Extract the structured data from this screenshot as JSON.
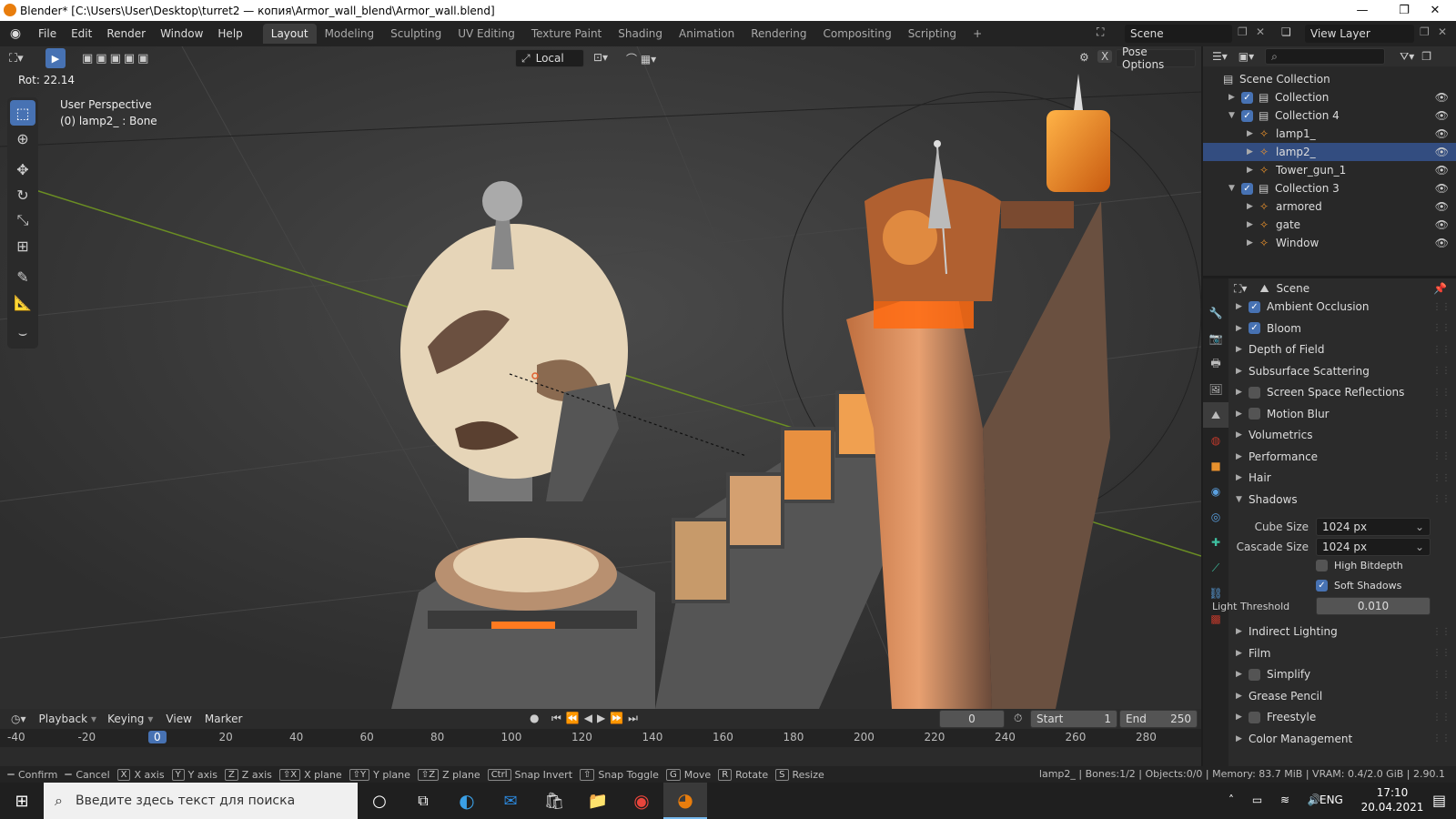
{
  "window": {
    "title": "Blender* [C:\\Users\\User\\Desktop\\turret2 — копия\\Armor_wall_blend\\Armor_wall.blend]",
    "min": "—",
    "max": "❐",
    "close": "✕"
  },
  "menu": [
    "File",
    "Edit",
    "Render",
    "Window",
    "Help"
  ],
  "workspaces": [
    "Layout",
    "Modeling",
    "Sculpting",
    "UV Editing",
    "Texture Paint",
    "Shading",
    "Animation",
    "Rendering",
    "Compositing",
    "Scripting",
    "+"
  ],
  "scene": {
    "label": "Scene",
    "view_layer": "View Layer"
  },
  "viewport": {
    "rot": "Rot: 22.14",
    "perspective": "User Perspective",
    "object": "(0) lamp2_ : Bone",
    "orientation": "Local",
    "pose_options": "Pose Options",
    "close": "X"
  },
  "outliner": {
    "search_placeholder": "",
    "rows": [
      {
        "label": "Scene Collection",
        "indent": 0
      },
      {
        "label": "Collection",
        "indent": 1
      },
      {
        "label": "Collection 4",
        "indent": 1
      },
      {
        "label": "lamp1_",
        "indent": 2
      },
      {
        "label": "lamp2_",
        "indent": 2,
        "selected": true
      },
      {
        "label": "Tower_gun_1",
        "indent": 2
      },
      {
        "label": "Collection 3",
        "indent": 1
      },
      {
        "label": "armored",
        "indent": 2
      },
      {
        "label": "gate",
        "indent": 2
      },
      {
        "label": "Window",
        "indent": 2
      }
    ]
  },
  "properties": {
    "context": "Scene",
    "sections": [
      {
        "label": "Ambient Occlusion",
        "checkbox": true,
        "checked": true
      },
      {
        "label": "Bloom",
        "checkbox": true,
        "checked": true
      },
      {
        "label": "Depth of Field",
        "checkbox": false
      },
      {
        "label": "Subsurface Scattering",
        "checkbox": false
      },
      {
        "label": "Screen Space Reflections",
        "checkbox": true,
        "checked": false
      },
      {
        "label": "Motion Blur",
        "checkbox": true,
        "checked": false
      },
      {
        "label": "Volumetrics",
        "checkbox": false
      },
      {
        "label": "Performance",
        "checkbox": false
      },
      {
        "label": "Hair",
        "checkbox": false
      },
      {
        "label": "Shadows",
        "checkbox": false,
        "open": true
      }
    ],
    "shadows": {
      "cube_size_label": "Cube Size",
      "cube_size": "1024 px",
      "cascade_size_label": "Cascade Size",
      "cascade_size": "1024 px",
      "high_bitdepth": "High Bitdepth",
      "soft_shadows": "Soft Shadows",
      "light_threshold_label": "Light Threshold",
      "light_threshold": "0.010"
    },
    "sections2": [
      {
        "label": "Indirect Lighting",
        "checkbox": false
      },
      {
        "label": "Film",
        "checkbox": false
      },
      {
        "label": "Simplify",
        "checkbox": true,
        "checked": false
      },
      {
        "label": "Grease Pencil",
        "checkbox": false
      },
      {
        "label": "Freestyle",
        "checkbox": true,
        "checked": false
      },
      {
        "label": "Color Management",
        "checkbox": false
      }
    ]
  },
  "timeline": {
    "menus": [
      "Playback",
      "Keying",
      "View",
      "Marker"
    ],
    "current_frame": "0",
    "start_label": "Start",
    "start": "1",
    "end_label": "End",
    "end": "250",
    "ruler": [
      "-40",
      "-20",
      "0",
      "20",
      "40",
      "60",
      "80",
      "100",
      "120",
      "140",
      "160",
      "180",
      "200",
      "220",
      "240",
      "260",
      "280"
    ]
  },
  "status": {
    "items": [
      {
        "key": "",
        "label": "Confirm"
      },
      {
        "key": "",
        "label": "Cancel"
      },
      {
        "key": "X",
        "label": "X axis"
      },
      {
        "key": "Y",
        "label": "Y axis"
      },
      {
        "key": "Z",
        "label": "Z axis"
      },
      {
        "key": "⇧X",
        "label": "X plane"
      },
      {
        "key": "⇧Y",
        "label": "Y plane"
      },
      {
        "key": "⇧Z",
        "label": "Z plane"
      },
      {
        "key": "Ctrl",
        "label": "Snap Invert"
      },
      {
        "key": "⇧",
        "label": "Snap Toggle"
      },
      {
        "key": "G",
        "label": "Move"
      },
      {
        "key": "R",
        "label": "Rotate"
      },
      {
        "key": "S",
        "label": "Resize"
      }
    ],
    "info": "lamp2_ | Bones:1/2 | Objects:0/0 | Memory: 83.7 MiB | VRAM: 0.4/2.0 GiB | 2.90.1"
  },
  "taskbar": {
    "search": "Введите здесь текст для поиска",
    "lang": "ENG",
    "time": "17:10",
    "date": "20.04.2021"
  },
  "colors": {
    "accent": "#4772b3",
    "selected_row": "#334d80",
    "active_frame": "#4772b3"
  }
}
